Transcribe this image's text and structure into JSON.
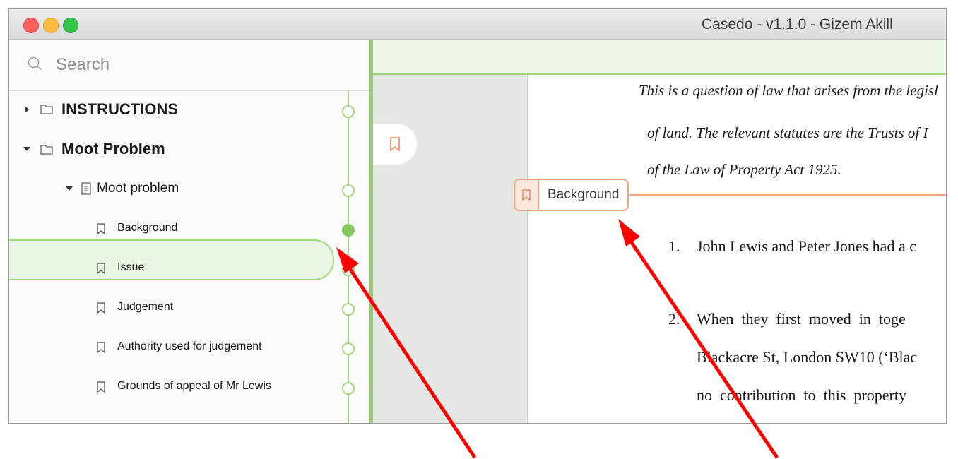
{
  "window": {
    "title": "Casedo - v1.1.0 - Gizem Akill"
  },
  "sidebar": {
    "search_placeholder": "Search",
    "items": [
      {
        "label": "INSTRUCTIONS"
      },
      {
        "label": "Moot Problem"
      },
      {
        "label": "Moot problem"
      },
      {
        "label": "Background"
      },
      {
        "label": "Issue"
      },
      {
        "label": "Judgement"
      },
      {
        "label": "Authority used for judgement"
      },
      {
        "label": "Grounds of appeal of Mr Lewis"
      }
    ],
    "selected": "Background"
  },
  "document": {
    "lines": [
      "This is a question of law that arises from the legisl",
      "of land. The relevant statutes are the Trusts of I",
      "of the Law of Property Act 1925."
    ],
    "bookmark_label": "Background",
    "paragraphs": [
      {
        "num": "1.",
        "text": "John Lewis and Peter Jones had a c"
      },
      {
        "num": "2.",
        "text": "When  they  first  moved  in  toge"
      }
    ],
    "continuation": [
      "Blackacre St, London SW10 (‘Blac",
      "no  contribution  to  this  property"
    ]
  },
  "colors": {
    "accent_green": "#a4d67e",
    "bookmark_orange": "#f3a07d",
    "annotation_arrow": "#ff0000"
  }
}
